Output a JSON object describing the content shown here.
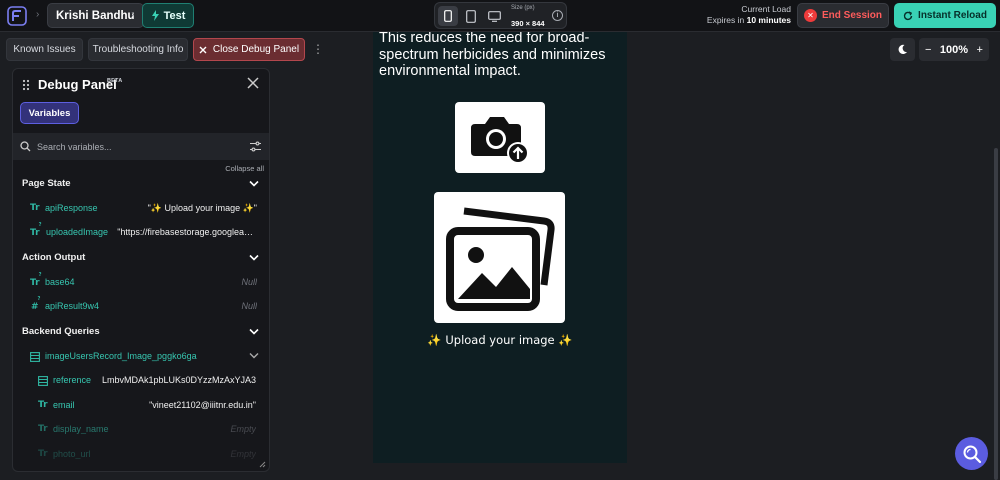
{
  "topbar": {
    "project_name": "Krishi Bandhu",
    "mode_label": "Test",
    "size_label": "Size (px)",
    "size_value": "390 × 844",
    "info_glyph": "i",
    "load_label": "Current Load",
    "expires_prefix": "Expires in ",
    "expires_value": "10 minutes",
    "end_session_label": "End Session",
    "instant_reload_label": "Instant Reload",
    "accent_color": "#39d2b5",
    "danger_color": "#ef3b3b"
  },
  "toolbar": {
    "known_issues_label": "Known Issues",
    "troubleshooting_label": "Troubleshooting Info",
    "close_debug_label": "Close Debug Panel",
    "kebab_glyph": "⋮",
    "zoom_minus": "−",
    "zoom_value": "100%",
    "zoom_plus": "+"
  },
  "debug_panel": {
    "title": "Debug Panel",
    "badge": "BETA",
    "tab_variables": "Variables",
    "search_placeholder": "Search variables...",
    "collapse_all": "Collapse all",
    "sections": {
      "page_state": "Page State",
      "action_output": "Action Output",
      "backend_queries": "Backend Queries"
    },
    "page_state": [
      {
        "icon": "Tr",
        "name": "apiResponse",
        "value": "\"✨ Upload your image ✨\""
      },
      {
        "icon": "Tr",
        "name": "uploadedImage",
        "value": "\"https://firebasestorage.googlea…"
      }
    ],
    "action_output": [
      {
        "icon": "Tr",
        "name": "base64",
        "value": "Null"
      },
      {
        "icon": "#",
        "name": "apiResult9w4",
        "value": "Null"
      }
    ],
    "query_name": "imageUsersRecord_Image_pggko6ga",
    "query_fields": [
      {
        "icon": "≣",
        "name": "reference",
        "value": "LmbvMDAk1pbLUKs0DYzzMzAxYJA3"
      },
      {
        "icon": "Tr",
        "name": "email",
        "value": "\"vineet21102@iiitnr.edu.in\""
      },
      {
        "icon": "Tr",
        "name": "display_name",
        "value": "Empty"
      },
      {
        "icon": "Tr",
        "name": "photo_url",
        "value": "Empty"
      }
    ]
  },
  "preview": {
    "body_text": "This reduces the need for broad-spectrum herbicides and minimizes environmental impact.",
    "upload_caption": "✨ Upload your image ✨"
  }
}
